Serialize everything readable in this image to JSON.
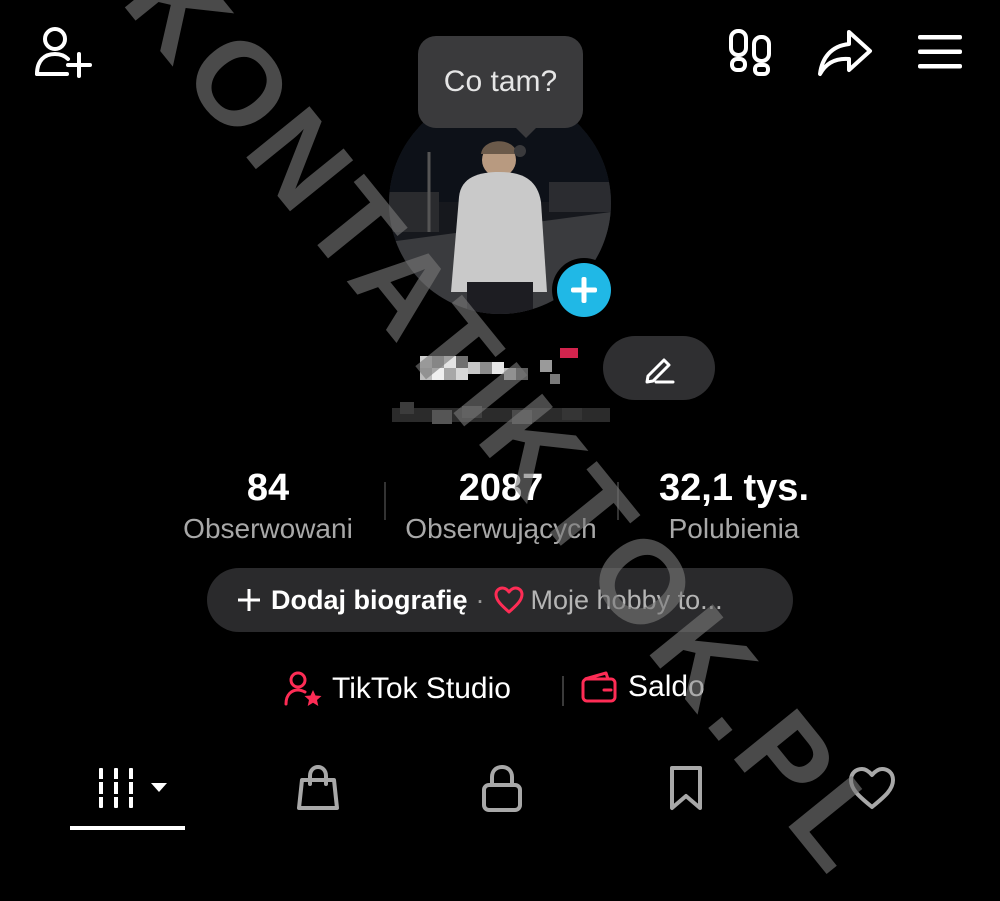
{
  "bubble": {
    "text": "Co tam?"
  },
  "stats": [
    {
      "value": "84",
      "label": "Obserwowani"
    },
    {
      "value": "2087",
      "label": "Obserwujących"
    },
    {
      "value": "32,1 tys.",
      "label": "Polubienia"
    }
  ],
  "bio": {
    "plus": "+",
    "add_label": "Dodaj biografię",
    "separator": "·",
    "hobby_label": "Moje hobby to..."
  },
  "tools": {
    "studio_label": "TikTok Studio",
    "balance_label": "Saldo"
  },
  "watermark": {
    "text": "KONTATIKTOK.PL"
  },
  "colors": {
    "accent_pink": "#fe2c55",
    "accent_blue": "#20b8e6",
    "background": "#000000",
    "pill": "#2a2a2c"
  },
  "icons": {
    "top_left": "add-friend-icon",
    "top_right": [
      "footprints-icon",
      "share-icon",
      "menu-icon"
    ],
    "tabs": [
      "videos-grid-icon",
      "shopping-bag-icon",
      "lock-icon",
      "bookmark-icon",
      "heart-icon"
    ]
  }
}
